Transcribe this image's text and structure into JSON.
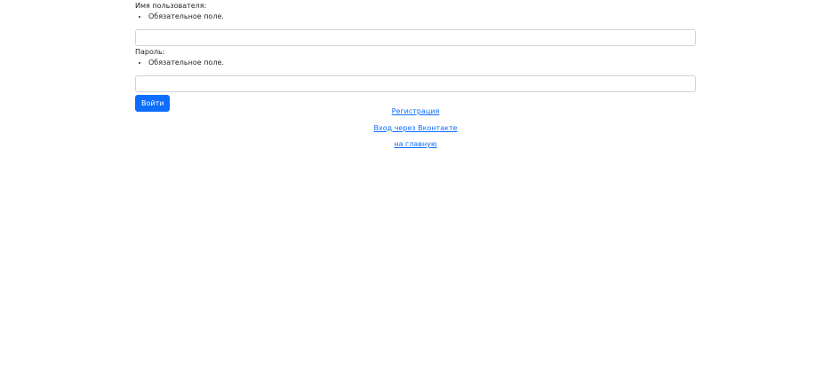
{
  "form": {
    "username_label": "Имя пользователя:",
    "username_error": "Обязательное поле.",
    "username_value": "",
    "password_label": "Пароль:",
    "password_error": "Обязательное поле.",
    "password_value": "",
    "submit_label": "Войти"
  },
  "links": {
    "register": "Регистрация",
    "vk_login": "Вход через Вконтакте",
    "home": "на главную"
  },
  "colors": {
    "primary": "#0d6efd",
    "input_border": "#ced4da",
    "text": "#212529"
  }
}
